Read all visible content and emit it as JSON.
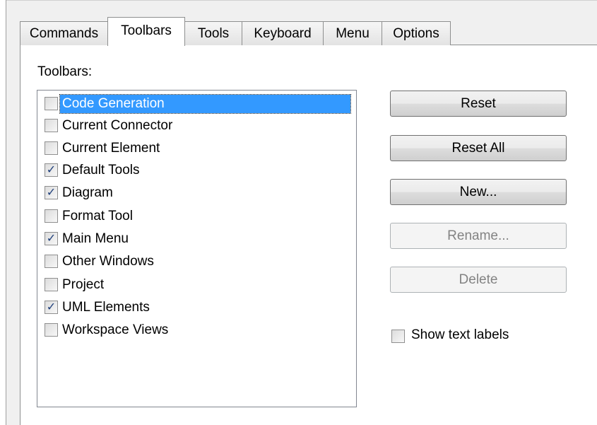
{
  "tabs": [
    {
      "label": "Commands",
      "active": false
    },
    {
      "label": "Toolbars",
      "active": true
    },
    {
      "label": "Tools",
      "active": false
    },
    {
      "label": "Keyboard",
      "active": false
    },
    {
      "label": "Menu",
      "active": false
    },
    {
      "label": "Options",
      "active": false
    }
  ],
  "toolbars_label": "Toolbars:",
  "toolbars": [
    {
      "label": "Code Generation",
      "checked": false,
      "selected": true
    },
    {
      "label": "Current Connector",
      "checked": false,
      "selected": false
    },
    {
      "label": "Current Element",
      "checked": false,
      "selected": false
    },
    {
      "label": "Default Tools",
      "checked": true,
      "selected": false
    },
    {
      "label": "Diagram",
      "checked": true,
      "selected": false
    },
    {
      "label": "Format Tool",
      "checked": false,
      "selected": false
    },
    {
      "label": "Main Menu",
      "checked": true,
      "selected": false
    },
    {
      "label": "Other Windows",
      "checked": false,
      "selected": false
    },
    {
      "label": "Project",
      "checked": false,
      "selected": false
    },
    {
      "label": "UML Elements",
      "checked": true,
      "selected": false
    },
    {
      "label": "Workspace Views",
      "checked": false,
      "selected": false
    }
  ],
  "buttons": {
    "reset": "Reset",
    "reset_all": "Reset All",
    "new": "New...",
    "rename": "Rename...",
    "delete": "Delete"
  },
  "show_text_labels": {
    "label": "Show text labels",
    "checked": false
  }
}
